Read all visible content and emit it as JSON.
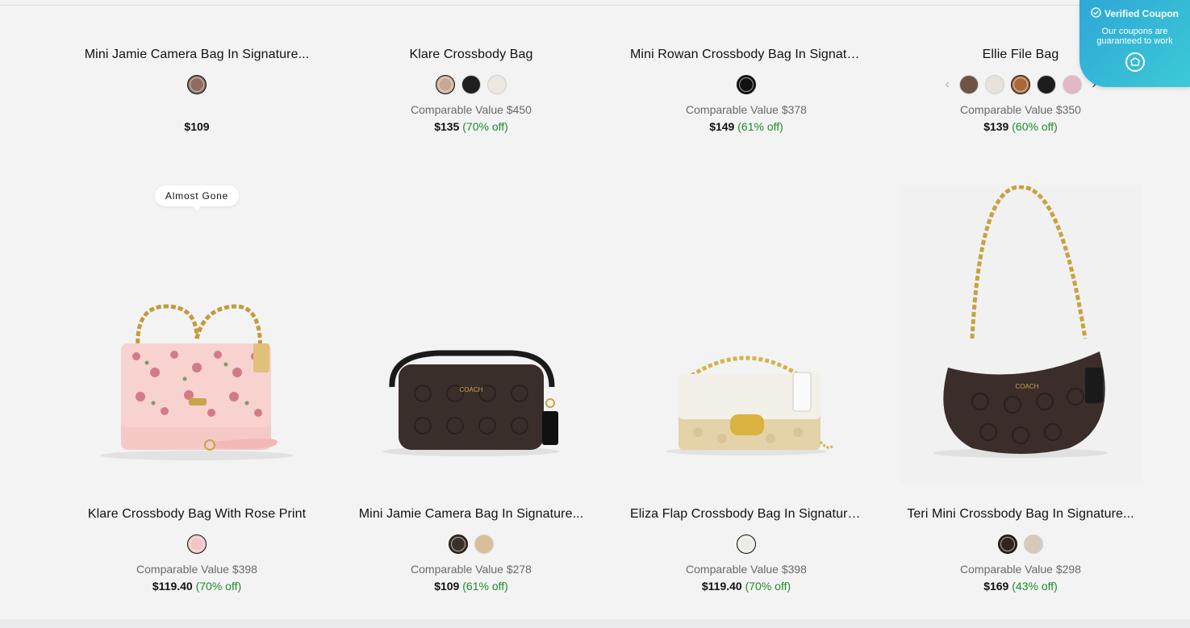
{
  "coupon": {
    "title": "Verified Coupon",
    "subtitle": "Our coupons are guaranteed to work",
    "icon": "check-circle-icon",
    "logo_icon": "extension-logo-icon"
  },
  "row1": [
    {
      "title": "Mini Jamie Camera Bag In Signature...",
      "swatches": [
        "#8c6d5f"
      ],
      "selected": 0,
      "comparable": "",
      "price": "$109",
      "off": ""
    },
    {
      "title": "Klare Crossbody Bag",
      "swatches": [
        "#c8a995",
        "#1f1f1f",
        "#ebe8e2"
      ],
      "selected": 0,
      "comparable": "Comparable Value $450",
      "price": "$135",
      "off": "(70% off)"
    },
    {
      "title": "Mini Rowan Crossbody Bag In Signature...",
      "swatches": [
        "#111111"
      ],
      "selected": 0,
      "comparable": "Comparable Value $378",
      "price": "$149",
      "off": "(61% off)"
    },
    {
      "title": "Ellie File Bag",
      "swatches": [
        "#6e5444",
        "#e7e3dc",
        "#a8693a",
        "#1d1d1d",
        "#e2b8c6"
      ],
      "selected": 2,
      "comparable": "Comparable Value $350",
      "price": "$139",
      "off": "(60% off)",
      "prev_arrow": "‹",
      "next_arrow": "›"
    }
  ],
  "row2": [
    {
      "title": "Klare Crossbody Bag With Rose Print",
      "swatches": [
        "#f2c6c6"
      ],
      "selected": 0,
      "comparable": "Comparable Value $398",
      "price": "$119.40",
      "off": "(70% off)",
      "badge": "Almost Gone"
    },
    {
      "title": "Mini Jamie Camera Bag In Signature...",
      "swatches": [
        "#3b2f2a",
        "#d9bf98"
      ],
      "selected": 0,
      "comparable": "Comparable Value $278",
      "price": "$109",
      "off": "(61% off)",
      "bag_brand": "COACH"
    },
    {
      "title": "Eliza Flap Crossbody Bag In Signature...",
      "swatches": [
        "#eeece8"
      ],
      "selected": 0,
      "comparable": "Comparable Value $398",
      "price": "$119.40",
      "off": "(70% off)"
    },
    {
      "title": "Teri Mini Crossbody Bag In Signature...",
      "swatches": [
        "#2d2522",
        "#d8cabb"
      ],
      "selected": 0,
      "comparable": "Comparable Value $298",
      "price": "$169",
      "off": "(43% off)",
      "bag_brand": "COACH"
    }
  ]
}
